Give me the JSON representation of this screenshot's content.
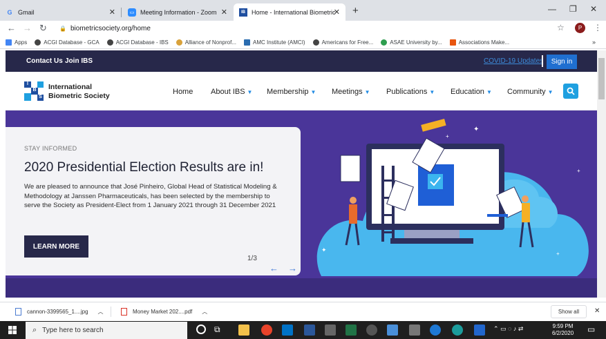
{
  "browser": {
    "tabs": [
      {
        "title": "Gmail",
        "icon": "G"
      },
      {
        "title": "Meeting Information - Zoom",
        "icon": "zoom"
      },
      {
        "title": "Home - International Biometric",
        "icon": "ibs"
      }
    ],
    "url": "biometricsociety.org/home",
    "profile_initial": "P",
    "bookmarks": [
      {
        "label": "Apps",
        "color": "#4285f4"
      },
      {
        "label": "ACGI Database - GCA",
        "color": "#444"
      },
      {
        "label": "ACGI Database - IBS",
        "color": "#444"
      },
      {
        "label": "Alliance of Nonprof...",
        "color": "#d9a23b"
      },
      {
        "label": "AMC Institute (AMCI)",
        "color": "#2b6cb0"
      },
      {
        "label": "Americans for Free...",
        "color": "#444"
      },
      {
        "label": "ASAE University by...",
        "color": "#2e9e4f"
      },
      {
        "label": "Associations Make...",
        "color": "#e8550f"
      }
    ]
  },
  "site": {
    "topbar": {
      "contact": "Contact Us",
      "join": "Join IBS",
      "covid": "COVID-19 Updates",
      "signin": "Sign in"
    },
    "logo": {
      "line1": "International",
      "line2": "Biometric Society",
      "letters": [
        "I",
        "B",
        "S"
      ]
    },
    "nav": [
      {
        "label": "Home",
        "dropdown": false
      },
      {
        "label": "About IBS",
        "dropdown": true
      },
      {
        "label": "Membership",
        "dropdown": true
      },
      {
        "label": "Meetings",
        "dropdown": true
      },
      {
        "label": "Publications",
        "dropdown": true
      },
      {
        "label": "Education",
        "dropdown": true
      },
      {
        "label": "Community",
        "dropdown": true
      }
    ],
    "hero": {
      "kicker": "STAY INFORMED",
      "headline": "2020 Presidential Election Results are in!",
      "body": "We are pleased to announce that José Pinheiro, Global Head of Statistical Modeling & Methodology at Janssen Pharmaceuticals, has been selected by the membership to serve the Society as President-Elect from 1 January 2021 through 31 December 2021",
      "button": "LEARN MORE",
      "counter": "1/3"
    }
  },
  "downloads": {
    "items": [
      {
        "name": "cannon-3399565_1....jpg",
        "icon": "image-file-icon"
      },
      {
        "name": "Money Market 202....pdf",
        "icon": "pdf-file-icon"
      }
    ],
    "show_all": "Show all"
  },
  "taskbar": {
    "search_placeholder": "Type here to search",
    "time": "9:59 PM",
    "date": "6/2/2020"
  },
  "colors": {
    "accent": "#1f6fd0",
    "hero_bg": "#4a3599",
    "topbar": "#27284a"
  }
}
